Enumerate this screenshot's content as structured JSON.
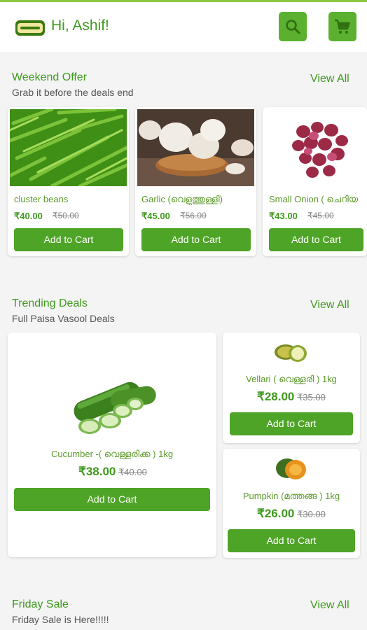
{
  "header": {
    "greeting": "Hi, Ashif!",
    "search_icon": "search-icon",
    "cart_icon": "cart-icon",
    "accent": "#5bb12f"
  },
  "weekend": {
    "title": "Weekend Offer",
    "subtitle": "Grab it before the deals end",
    "view_all": "View All",
    "items": [
      {
        "name": "cluster beans",
        "price": "₹40.00",
        "old_price": "₹50.00",
        "button": "Add to Cart"
      },
      {
        "name": "Garlic (വെളുത്തുള്ളി)",
        "price": "₹45.00",
        "old_price": "₹56.00",
        "button": "Add to Cart"
      },
      {
        "name": "Small Onion ( ചെറിയ",
        "price": "₹43.00",
        "old_price": "₹45.00",
        "button": "Add to Cart"
      }
    ]
  },
  "trending": {
    "title": "Trending Deals",
    "subtitle": "Full Paisa Vasool Deals",
    "view_all": "View All",
    "big": {
      "name": "Cucumber -( വെള്ളരിക്ക ) 1kg",
      "price": "₹38.00",
      "old_price": "₹40.00",
      "button": "Add to Cart"
    },
    "small": [
      {
        "name": "Vellari ( വെള്ളരി ) 1kg",
        "price": "₹28.00",
        "old_price": "₹35.00",
        "button": "Add to Cart"
      },
      {
        "name": "Pumpkin (മത്തങ്ങ ) 1kg",
        "price": "₹26.00",
        "old_price": "₹30.00",
        "button": "Add to Cart"
      }
    ]
  },
  "friday": {
    "title": "Friday Sale",
    "subtitle": "Friday Sale is Here!!!!!",
    "view_all": "View All"
  }
}
